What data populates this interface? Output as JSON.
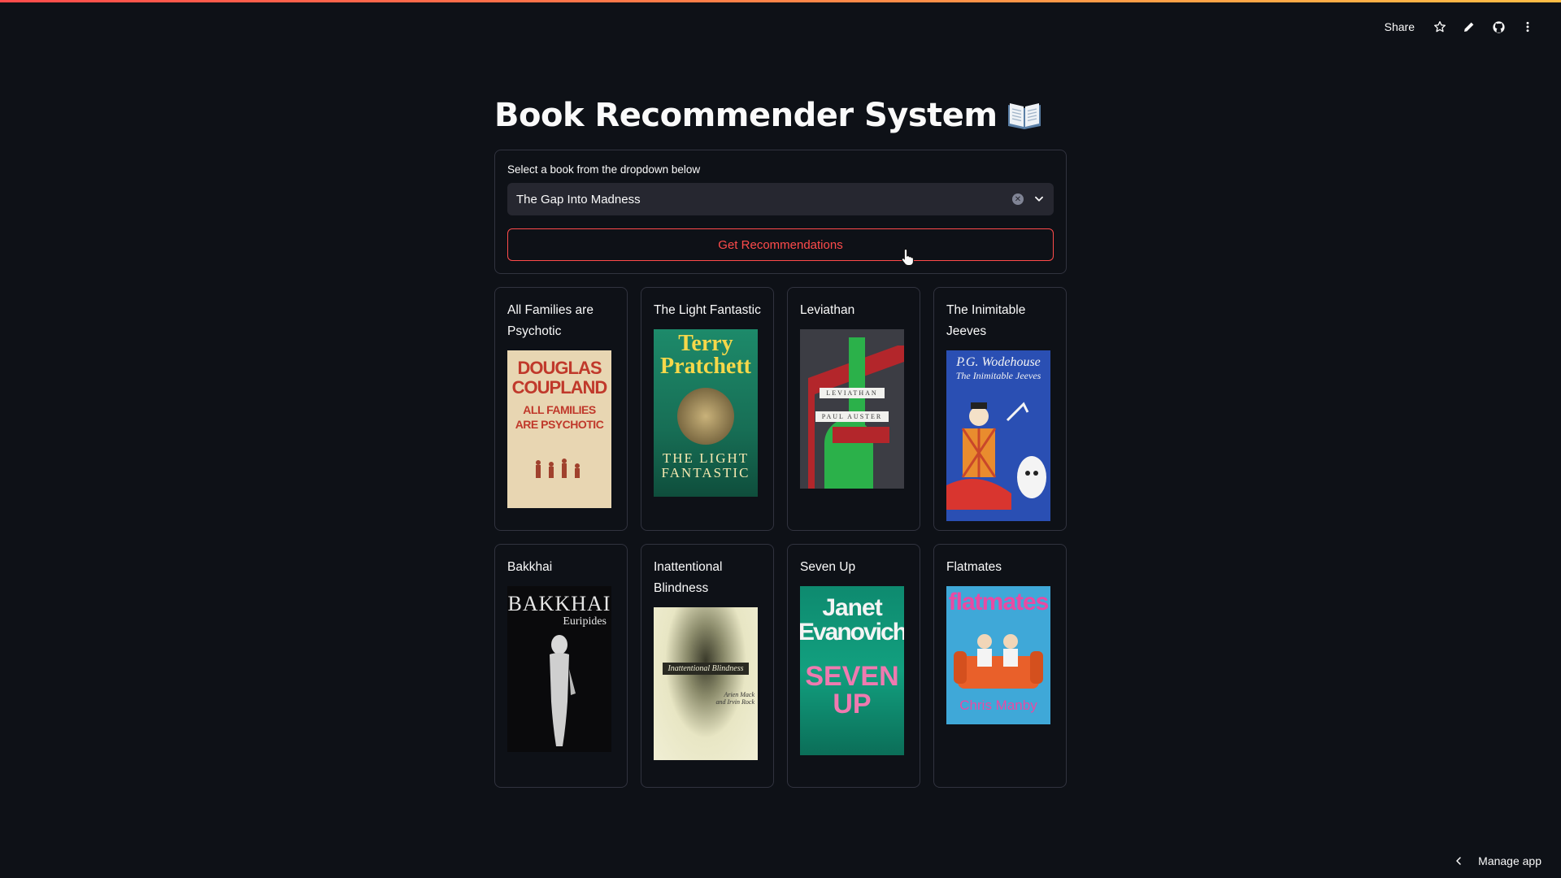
{
  "app": {
    "title": "Book Recommender System",
    "title_emoji": "📖"
  },
  "toolbar": {
    "share_label": "Share",
    "icons": [
      "star-icon",
      "edit-icon",
      "github-icon",
      "more-icon"
    ]
  },
  "form": {
    "select_label": "Select a book from the dropdown below",
    "selected_book": "The Gap Into Madness",
    "button_label": "Get Recommendations"
  },
  "recommendations": [
    {
      "title": "All Families are Psychotic",
      "cover": {
        "lines": [
          "DOUGLAS",
          "COUPLAND",
          "ALL FAMILIES",
          "ARE PSYCHOTIC"
        ]
      }
    },
    {
      "title": "The Light Fantastic",
      "cover": {
        "lines": [
          "Terry",
          "Pratchett",
          "THE LIGHT",
          "FANTASTIC"
        ]
      }
    },
    {
      "title": "Leviathan",
      "cover": {
        "lines": [
          "LEVIATHAN",
          "PAUL AUSTER"
        ]
      }
    },
    {
      "title": "The Inimitable Jeeves",
      "cover": {
        "lines": [
          "P.G. Wodehouse",
          "The Inimitable Jeeves"
        ]
      }
    },
    {
      "title": "Bakkhai",
      "cover": {
        "lines": [
          "BAKKHAI",
          "Euripides"
        ]
      }
    },
    {
      "title": "Inattentional Blindness",
      "cover": {
        "lines": [
          "Inattentional Blindness",
          "Arien Mack",
          "and Irvin Rock"
        ]
      }
    },
    {
      "title": "Seven Up",
      "cover": {
        "lines": [
          "Janet",
          "Evanovich",
          "SEVEN",
          "UP"
        ]
      }
    },
    {
      "title": "Flatmates",
      "cover": {
        "lines": [
          "flatmates",
          "Chris Manby"
        ]
      }
    }
  ],
  "footer": {
    "manage_label": "Manage app"
  },
  "colors": {
    "background": "#0e1117",
    "accent": "#ff4b4b",
    "border": "#31333f",
    "input_bg": "#262730"
  }
}
